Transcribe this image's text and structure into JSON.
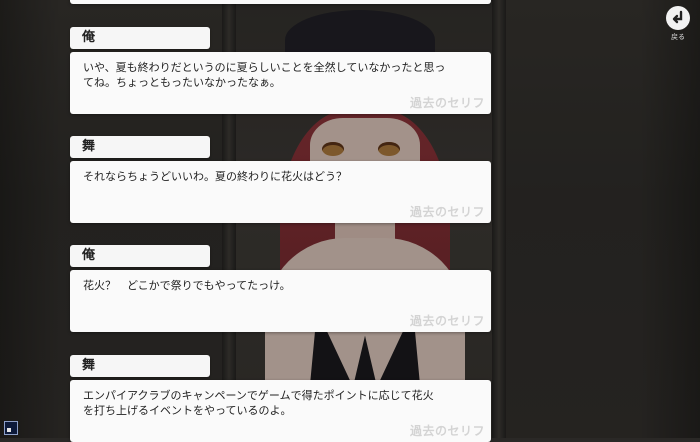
{
  "back_button": {
    "label": "戻る",
    "icon": "return-arrow-icon"
  },
  "corner_button": {
    "icon": "window-toggle-icon"
  },
  "log_entries": [
    {
      "speaker": "俺",
      "text": "いや、夏も終わりだというのに夏らしいことを全然していなかったと思っ\nてね。ちょっともったいなかったなぁ。",
      "voice_label": "過去のセリフ"
    },
    {
      "speaker": "舞",
      "text": "それならちょうどいいわ。夏の終わりに花火はどう？",
      "voice_label": "過去のセリフ"
    },
    {
      "speaker": "俺",
      "text": "花火？　どこかで祭りでもやってたっけ。",
      "voice_label": "過去のセリフ"
    },
    {
      "speaker": "舞",
      "text": "エンパイアクラブのキャンペーンでゲームで得たポイントに応じて花火\nを打ち上げるイベントをやっているのよ。",
      "voice_label": "過去のセリフ"
    }
  ],
  "colors": {
    "panel": "#fafafa",
    "name_tag": "#f6f6f6",
    "background": "#2a2826",
    "hair": "#8e2f36"
  }
}
